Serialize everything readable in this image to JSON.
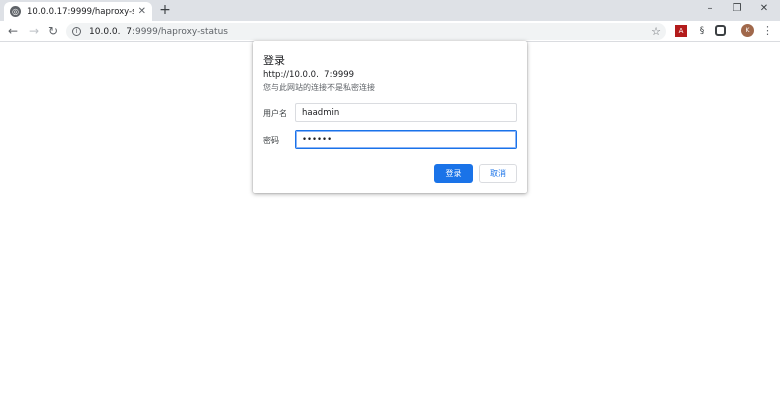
{
  "tab": {
    "favicon": "globe-icon",
    "title": "10.0.0.17:9999/haproxy-status",
    "close_glyph": "✕",
    "new_tab_glyph": "+"
  },
  "window_controls": {
    "minimize": "–",
    "restore": "❐",
    "close": "✕"
  },
  "toolbar": {
    "back": "←",
    "forward": "→",
    "reload": "↻",
    "info_glyph": "i",
    "url_host": "10.0.0.  7",
    "url_path": ":9999/haproxy-status",
    "star": "☆",
    "avatar_letter": "K",
    "menu": "⋮",
    "extensions": [
      "pdf-extension-icon",
      "script-extension-icon",
      "screenshot-extension-icon",
      "puzzle-icon"
    ]
  },
  "dialog": {
    "title": "登录",
    "origin": "http://10.0.0.  7:9999",
    "warning": "您与此网站的连接不是私密连接",
    "username_label": "用户名",
    "username_value": "haadmin",
    "password_label": "密码",
    "password_value": "••••••",
    "ok_label": "登录",
    "cancel_label": "取消"
  },
  "colors": {
    "accent": "#1a73e8",
    "tabstrip": "#dee1e6",
    "omnibox": "#f1f3f4"
  }
}
